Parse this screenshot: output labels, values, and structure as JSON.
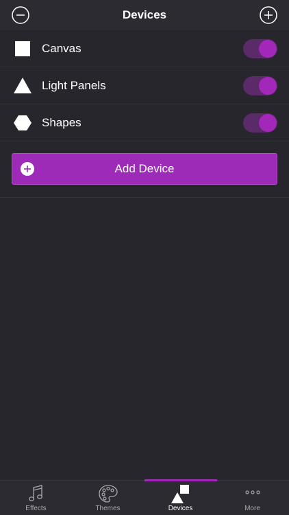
{
  "header": {
    "title": "Devices",
    "left_icon": "minus-circle-icon",
    "right_icon": "plus-circle-icon"
  },
  "devices": [
    {
      "label": "Canvas",
      "icon": "square-icon",
      "enabled": true
    },
    {
      "label": "Light Panels",
      "icon": "triangle-icon",
      "enabled": true
    },
    {
      "label": "Shapes",
      "icon": "hexagon-icon",
      "enabled": true
    }
  ],
  "add_device": {
    "label": "Add Device",
    "icon": "plus-circle-icon"
  },
  "tabs": [
    {
      "label": "Effects",
      "icon": "music-note-icon",
      "active": false
    },
    {
      "label": "Themes",
      "icon": "palette-icon",
      "active": false
    },
    {
      "label": "Devices",
      "icon": "devices-icon",
      "active": true
    },
    {
      "label": "More",
      "icon": "ellipsis-icon",
      "active": false
    }
  ],
  "colors": {
    "accent": "#a128b9",
    "toggle_track": "#5b2a68",
    "background": "#27262c",
    "bar": "#2c2b31"
  }
}
